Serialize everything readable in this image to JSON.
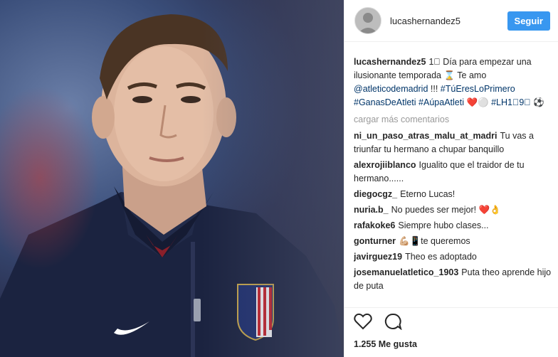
{
  "post": {
    "author": "lucashernandez5",
    "follow_label": "Seguir",
    "caption_parts": {
      "t1": "1⃣ Día para empezar una ilusionante temporada ⌛ Te amo ",
      "mention": "@atleticodemadrid",
      "t2": " !!! ",
      "tag1": "#TúEresLoPrimero",
      "t3": " ",
      "tag2": "#GanasDeAtleti",
      "t4": " ",
      "tag3": "#AúpaAtleti",
      "t5": " ❤️⚪ ",
      "tag4": "#LH1⃣9⃣",
      "t6": " ⚽"
    },
    "load_more": "cargar más comentarios",
    "likes": "1.255 Me gusta"
  },
  "comments": [
    {
      "user": "ni_un_paso_atras_malu_at_madri",
      "text": "Tu vas a triunfar tu hermano a chupar banquillo"
    },
    {
      "user": "alexrojiiblanco",
      "text": "Igualito que el traidor de tu hermano......"
    },
    {
      "user": "diegocgz_",
      "text": "Eterno Lucas!"
    },
    {
      "user": "nuria.b_",
      "text": "No puedes ser mejor! ❤️👌"
    },
    {
      "user": "rafakoke6",
      "text": "Siempre hubo clases..."
    },
    {
      "user": "gonturner",
      "text": "💪🏼📱te queremos"
    },
    {
      "user": "javirguez19",
      "text": "Theo es adoptado"
    },
    {
      "user": "josemanuelatletico_1903",
      "text": "Puta theo aprende hijo de puta"
    }
  ],
  "icons": [
    "heart-icon",
    "comment-icon"
  ]
}
